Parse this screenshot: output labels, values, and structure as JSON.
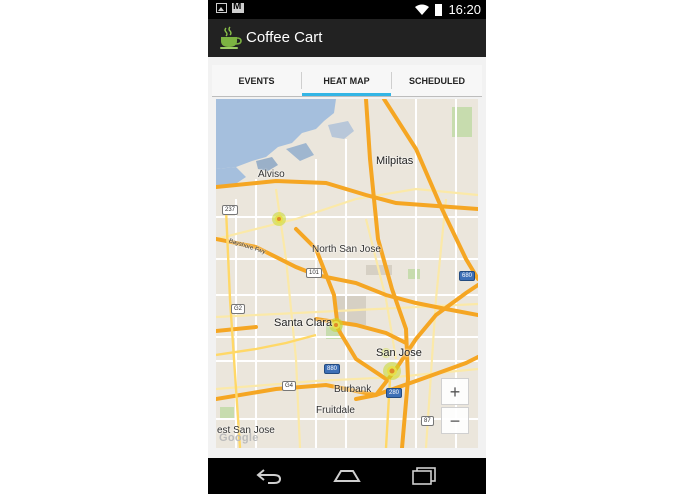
{
  "status_bar": {
    "time": "16:20",
    "icons": [
      "image-notification-icon",
      "gmail-notification-icon",
      "wifi-icon",
      "battery-icon"
    ]
  },
  "app": {
    "title": "Coffee Cart",
    "icon": "coffee-cup-icon",
    "accent_color": "#33b5e5"
  },
  "tabs": [
    {
      "label": "EVENTS",
      "active": false
    },
    {
      "label": "HEAT MAP",
      "active": true
    },
    {
      "label": "SCHEDULED",
      "active": false
    }
  ],
  "map": {
    "labels": {
      "milpitas": "Milpitas",
      "alviso": "Alviso",
      "north_san_jose": "North San Jose",
      "santa_clara": "Santa Clara",
      "san_jose": "San Jose",
      "burbank": "Burbank",
      "fruitdale": "Fruitdale",
      "east_san_jose_partial": "est San Jose",
      "bayshore": "Bayshore Fwy"
    },
    "shields": {
      "s237": "237",
      "s101": "101",
      "s680": "680",
      "sg2": "G2",
      "sg4": "G4",
      "s880": "880",
      "s280": "280",
      "s87": "87"
    },
    "logo": "Google",
    "zoom_in": "+",
    "zoom_out": "−",
    "heat_color": "#c8d82c"
  },
  "nav_bar": {
    "icons": [
      "back-icon",
      "home-icon",
      "recent-apps-icon"
    ]
  }
}
